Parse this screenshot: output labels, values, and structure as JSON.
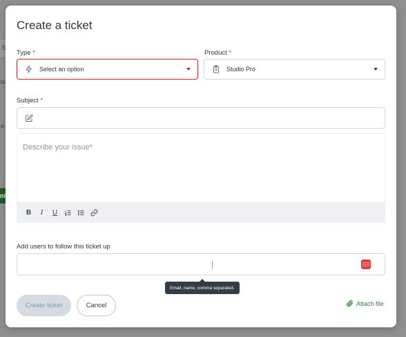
{
  "background": {
    "frag1": "S",
    "frag2": "se",
    "frag3": "e",
    "frag4": "ni"
  },
  "modal": {
    "title": "Create a ticket",
    "type_field": {
      "label": "Type",
      "required_mark": "*",
      "value": "Select an option",
      "icon": "bolt-icon"
    },
    "product_field": {
      "label": "Product",
      "required_mark": "*",
      "value": "Studio Pro",
      "icon": "clipboard-icon"
    },
    "subject_field": {
      "label": "Subject",
      "required_mark": "*",
      "value": "",
      "icon": "edit-icon"
    },
    "description": {
      "placeholder": "Describe your issue*"
    },
    "toolbar": {
      "bold": "B",
      "italic": "I",
      "underline": "U",
      "icons": [
        "bold-icon",
        "italic-icon",
        "underline-icon",
        "ordered-list-icon",
        "bullet-list-icon",
        "link-icon"
      ]
    },
    "followers_field": {
      "label": "Add users to follow this ticket up",
      "value": "",
      "icon": "password-dots-icon"
    },
    "tooltip": "Email, name, comma separated.",
    "buttons": {
      "create": "Create ticket",
      "cancel": "Cancel"
    },
    "attach": {
      "label": "Attach file",
      "icon": "paperclip-icon"
    }
  },
  "colors": {
    "error_border": "#c62828",
    "attach_green": "#2e7d32",
    "disabled_button_bg": "#d5dbe3",
    "tooltip_bg": "#333d47",
    "password_icon_red": "#e53935"
  }
}
